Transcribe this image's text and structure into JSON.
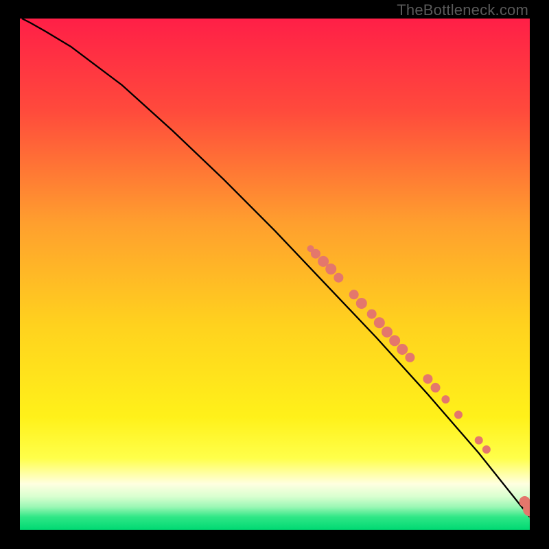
{
  "watermark": "TheBottleneck.com",
  "chart_data": {
    "type": "line",
    "title": "",
    "xlabel": "",
    "ylabel": "",
    "xlim": [
      0,
      100
    ],
    "ylim": [
      0,
      100
    ],
    "grid": false,
    "legend": false,
    "gradient_stops": [
      {
        "offset": 0,
        "color": "#ff1f47"
      },
      {
        "offset": 0.18,
        "color": "#ff4a3c"
      },
      {
        "offset": 0.4,
        "color": "#ff9f2e"
      },
      {
        "offset": 0.6,
        "color": "#ffd21e"
      },
      {
        "offset": 0.78,
        "color": "#fff11a"
      },
      {
        "offset": 0.86,
        "color": "#ffff4a"
      },
      {
        "offset": 0.91,
        "color": "#ffffe0"
      },
      {
        "offset": 0.935,
        "color": "#d9ffd0"
      },
      {
        "offset": 0.955,
        "color": "#9cf7b5"
      },
      {
        "offset": 0.975,
        "color": "#2fe786"
      },
      {
        "offset": 1.0,
        "color": "#00d973"
      }
    ],
    "series": [
      {
        "name": "bottleneck-curve",
        "x": [
          0.4,
          2,
          5,
          10,
          20,
          30,
          40,
          50,
          60,
          70,
          80,
          90,
          98,
          100
        ],
        "y": [
          100,
          99.2,
          97.5,
          94.5,
          87,
          78,
          68.5,
          58.5,
          48,
          37.5,
          26.5,
          15,
          5,
          2.5
        ]
      }
    ],
    "scatter": {
      "name": "highlight-points",
      "color": "#e4776c",
      "points": [
        {
          "x": 57,
          "y": 55,
          "r": 5
        },
        {
          "x": 58,
          "y": 54,
          "r": 7
        },
        {
          "x": 59.5,
          "y": 52.5,
          "r": 8
        },
        {
          "x": 61,
          "y": 51,
          "r": 8
        },
        {
          "x": 62.5,
          "y": 49.3,
          "r": 7
        },
        {
          "x": 65.5,
          "y": 46,
          "r": 7
        },
        {
          "x": 67,
          "y": 44.3,
          "r": 8
        },
        {
          "x": 69,
          "y": 42.2,
          "r": 7
        },
        {
          "x": 70.5,
          "y": 40.5,
          "r": 8
        },
        {
          "x": 72,
          "y": 38.7,
          "r": 8
        },
        {
          "x": 73.5,
          "y": 37,
          "r": 8
        },
        {
          "x": 75,
          "y": 35.3,
          "r": 8
        },
        {
          "x": 76.5,
          "y": 33.7,
          "r": 7
        },
        {
          "x": 80,
          "y": 29.5,
          "r": 7
        },
        {
          "x": 81.5,
          "y": 27.8,
          "r": 7
        },
        {
          "x": 83.5,
          "y": 25.5,
          "r": 6
        },
        {
          "x": 86,
          "y": 22.5,
          "r": 6
        },
        {
          "x": 90,
          "y": 17.5,
          "r": 6
        },
        {
          "x": 91.5,
          "y": 15.7,
          "r": 6
        },
        {
          "x": 99,
          "y": 5.5,
          "r": 8
        },
        {
          "x": 100,
          "y": 4,
          "r": 10
        },
        {
          "x": 101,
          "y": 2.5,
          "r": 8
        }
      ]
    }
  }
}
